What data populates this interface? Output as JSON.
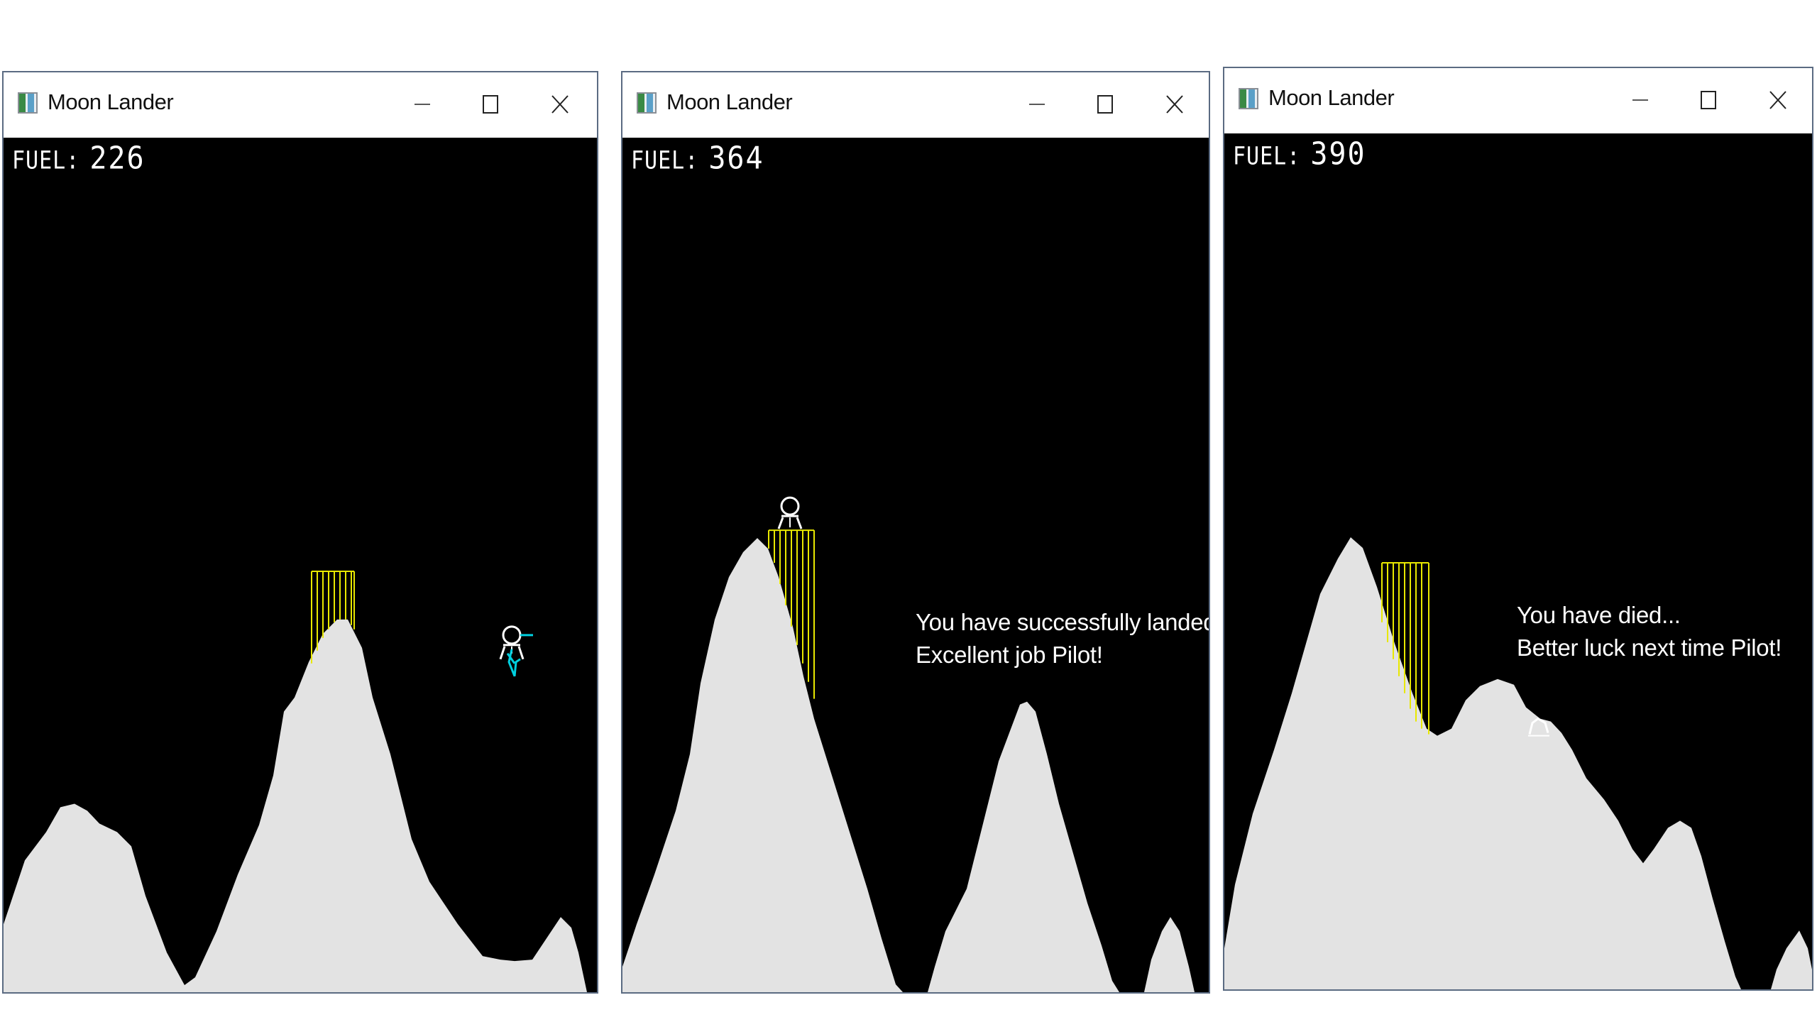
{
  "windows": [
    {
      "title": "Moon Lander",
      "fuel_label": "FUEL:",
      "fuel_value": "226",
      "message_line1": "",
      "message_line2": ""
    },
    {
      "title": "Moon Lander",
      "fuel_label": "FUEL:",
      "fuel_value": "364",
      "message_line1": "You have successfully landed!",
      "message_line2": "Excellent job Pilot!"
    },
    {
      "title": "Moon Lander",
      "fuel_label": "FUEL:",
      "fuel_value": "390",
      "message_line1": "You have died...",
      "message_line2": "Better luck next time Pilot!"
    }
  ],
  "icons": {
    "app": "moon-lander-app-icon",
    "minimize": "minimize-icon",
    "maximize": "maximize-icon",
    "close": "close-icon"
  },
  "colors": {
    "terrain": "#e3e3e3",
    "sky": "#000000",
    "landing_pad": "#e8e800",
    "lander": "#ffffff",
    "thrust": "#00d0e0"
  }
}
